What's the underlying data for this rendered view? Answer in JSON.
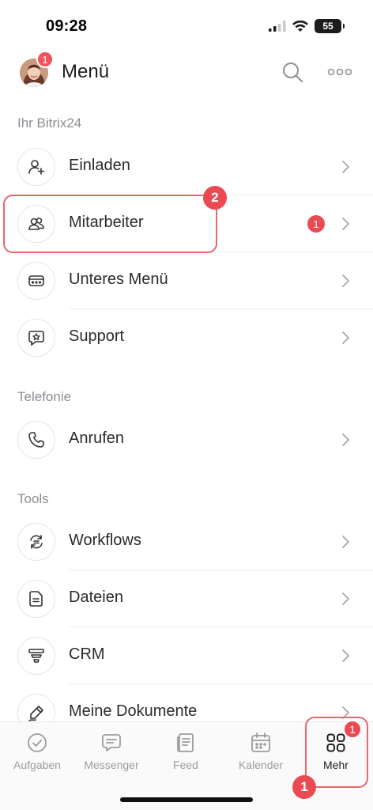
{
  "status_bar": {
    "time": "09:28",
    "battery": "55"
  },
  "header": {
    "title": "Menü",
    "avatar_badge": "1"
  },
  "sections": {
    "bitrix": "Ihr Bitrix24",
    "telefonie": "Telefonie",
    "tools": "Tools"
  },
  "items": {
    "einladen": "Einladen",
    "mitarbeiter": "Mitarbeiter",
    "mitarbeiter_badge": "1",
    "unteres_menu": "Unteres Menü",
    "support": "Support",
    "anrufen": "Anrufen",
    "workflows": "Workflows",
    "dateien": "Dateien",
    "crm": "CRM",
    "dokumente": "Meine Dokumente"
  },
  "callouts": {
    "first": "1",
    "second": "2"
  },
  "tabs": {
    "aufgaben": "Aufgaben",
    "messenger": "Messenger",
    "feed": "Feed",
    "kalender": "Kalender",
    "mehr": "Mehr",
    "mehr_badge": "1"
  },
  "icons": {
    "search": "search-icon",
    "more": "more-dots-icon",
    "chevron": "chevron-right-icon"
  },
  "colors": {
    "accent_red": "#ea4b53",
    "highlight": "#e6676c",
    "muted": "#8a8d91"
  }
}
